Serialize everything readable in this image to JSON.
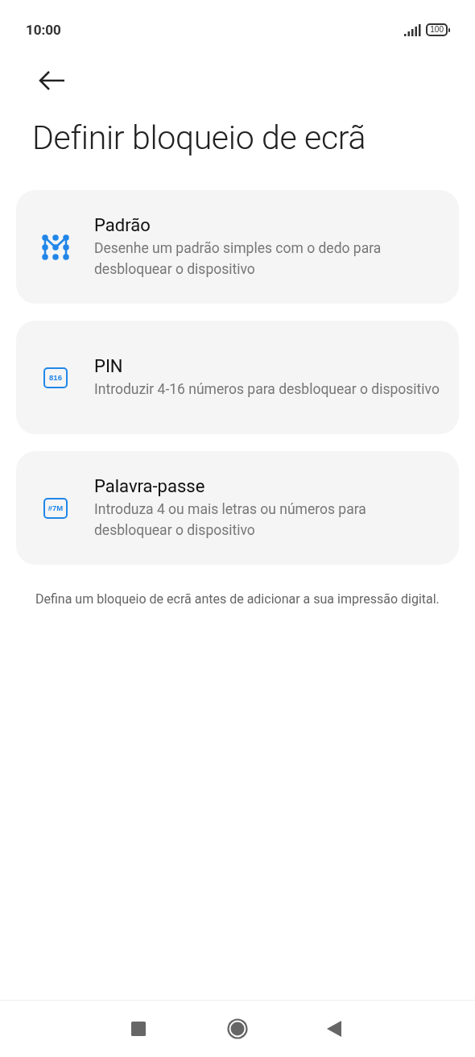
{
  "status_bar": {
    "time": "10:00",
    "battery": "100"
  },
  "title": "Definir bloqueio de ecrã",
  "options": [
    {
      "kind": "pattern",
      "title": "Padrão",
      "description": "Desenhe um padrão simples com o dedo para desbloquear o dispositivo"
    },
    {
      "kind": "pin",
      "icon_text": "816",
      "title": "PIN",
      "description": "Introduzir 4-16 números para desbloquear o dispositivo"
    },
    {
      "kind": "password",
      "icon_text": "#7M",
      "title": "Palavra-passe",
      "description": "Introduza 4 ou mais letras ou números para desbloquear o dispositivo"
    }
  ],
  "footnote": "Defina um bloqueio de ecrã antes de adicionar a sua impressão digital."
}
